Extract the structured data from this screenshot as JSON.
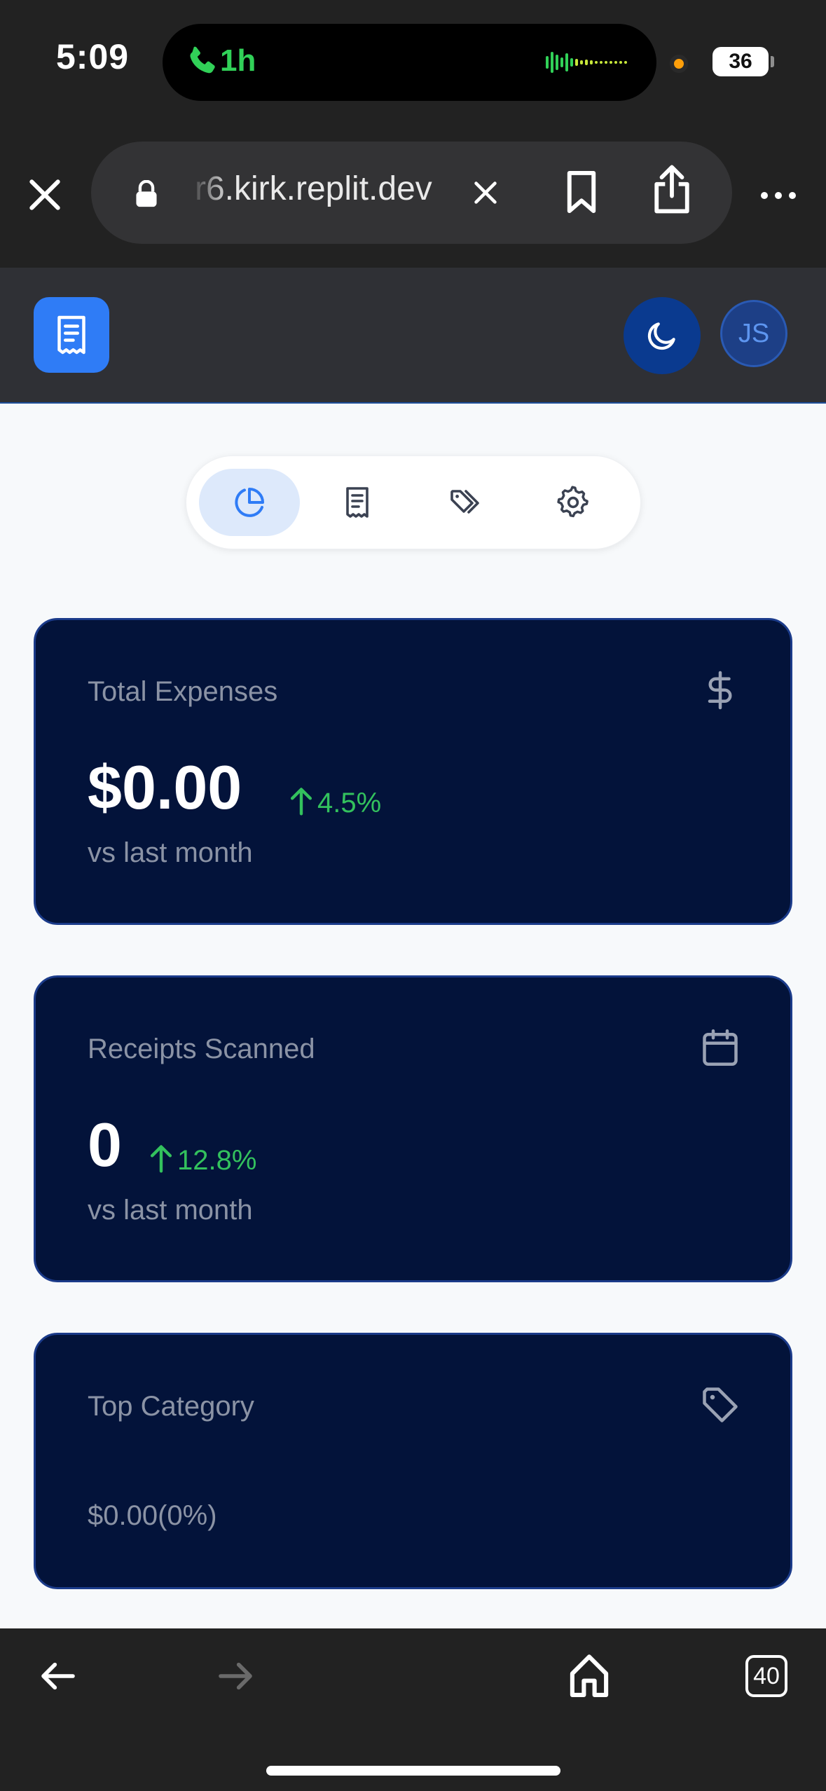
{
  "status_bar": {
    "time": "5:09",
    "call_duration": "1h",
    "battery_level": "36",
    "call_color": "#31d158"
  },
  "browser": {
    "url_text": "r6.kirk.replit.dev",
    "icons": [
      "close-icon",
      "lock-icon",
      "clear-icon",
      "bookmark-icon",
      "share-icon",
      "more-icon"
    ]
  },
  "app_header": {
    "logo_icon": "receipt-icon",
    "theme_icon": "moon-icon",
    "avatar_initials": "JS",
    "accent_color": "#2f7cf6"
  },
  "tabs": [
    {
      "icon": "pie-chart-icon",
      "active": true
    },
    {
      "icon": "receipt-icon",
      "active": false
    },
    {
      "icon": "tags-icon",
      "active": false
    },
    {
      "icon": "gear-icon",
      "active": false
    }
  ],
  "cards": {
    "total_expenses": {
      "title": "Total Expenses",
      "value": "$0.00",
      "trend": "4.5%",
      "subtitle": "vs last month",
      "icon": "dollar-icon"
    },
    "receipts_scanned": {
      "title": "Receipts Scanned",
      "value": "0",
      "trend": "12.8%",
      "subtitle": "vs last month",
      "icon": "calendar-icon"
    },
    "top_category": {
      "title": "Top Category",
      "amount": "$0.00(0%)",
      "icon": "tag-icon"
    },
    "card_bg": "#03133a",
    "trend_color": "#33c15d"
  },
  "bottom_bar": {
    "tab_count": "40",
    "icons": [
      "back-arrow-icon",
      "forward-arrow-icon",
      "home-icon",
      "tabs-icon"
    ]
  }
}
